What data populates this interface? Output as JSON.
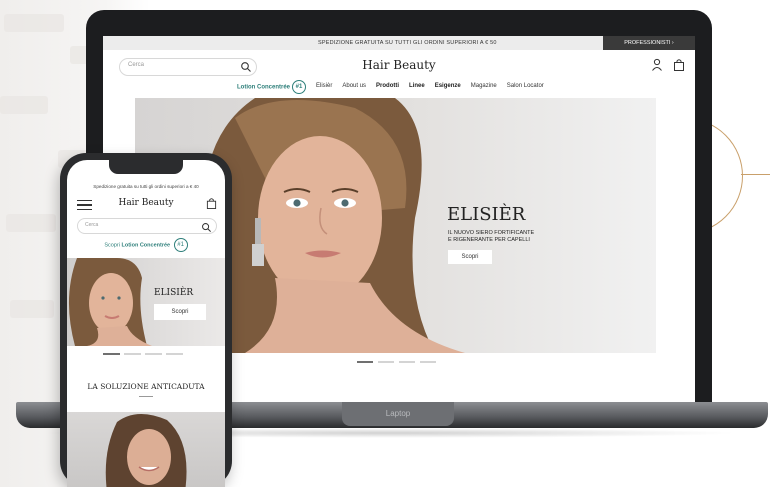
{
  "laptop": {
    "base_label": "Laptop",
    "site": {
      "shipping_banner": "SPEDIZIONE GRATUITA SU TUTTI GLI ORDINI SUPERIORI A € 50",
      "pro_label": "PROFESSIONISTI",
      "search_placeholder": "Cerca",
      "brand": "Hair Beauty",
      "nav": {
        "promo": "Lotion Concentrée",
        "promo_badge": "#1",
        "items": [
          "Elisièr",
          "About us",
          "Prodotti",
          "Linee",
          "Esigenze",
          "Magazine",
          "Salon Locator"
        ]
      },
      "hero": {
        "title": "ELISIÈR",
        "subtitle_line1": "IL NUOVO SIERO FORTIFICANTE",
        "subtitle_line2": "E RIGENERANTE PER CAPELLI",
        "button": "Scopri",
        "active_slide": 1,
        "slide_count": 4
      }
    }
  },
  "phone": {
    "shipping_banner": "Spedizione gratuita su tutti gli ordini superiori a € 40",
    "brand": "Hair Beauty",
    "search_placeholder": "Cerca",
    "promo_prefix": "Scopri",
    "promo": "Lotion Concentrée",
    "promo_badge": "#1",
    "hero": {
      "title": "ELISIÈR",
      "button": "Scopri",
      "active_slide": 1,
      "slide_count": 4
    },
    "section_title": "LA SOLUZIONE ANTICADUTA"
  },
  "colors": {
    "accent_teal": "#2e7f7a",
    "gold": "#c9a06b",
    "device_dark": "#1c1d1f"
  }
}
